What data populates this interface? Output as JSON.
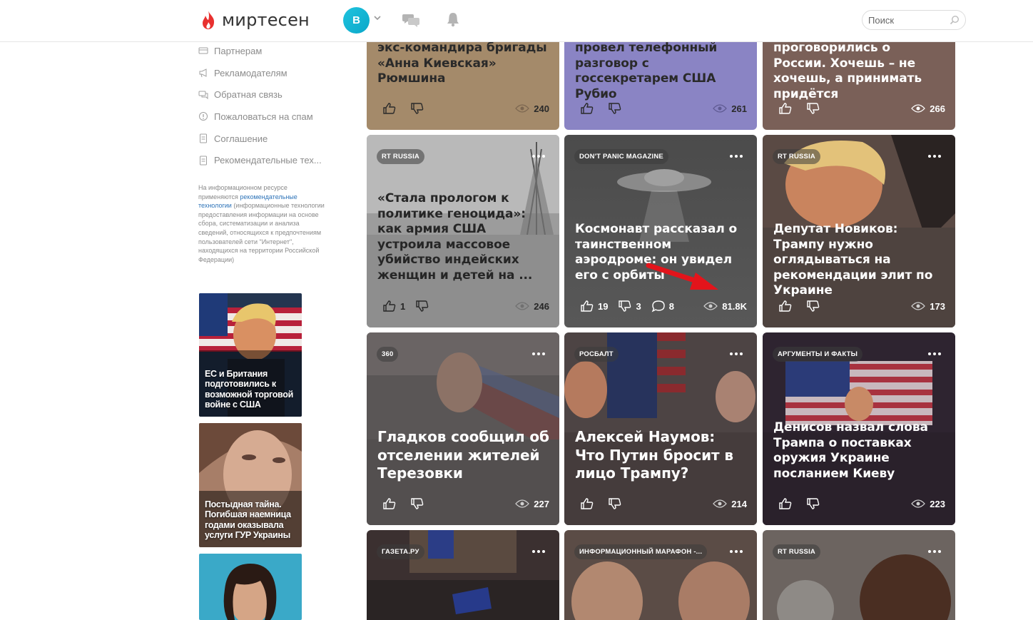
{
  "header": {
    "logo_text": "миртесен",
    "avatar_letter": "В",
    "search_placeholder": "Поиск"
  },
  "sidebar": {
    "links": [
      {
        "label": "Партнерам",
        "icon": "card-icon"
      },
      {
        "label": "Рекламодателям",
        "icon": "megaphone-icon"
      },
      {
        "label": "Обратная связь",
        "icon": "chat-bubbles-icon"
      },
      {
        "label": "Пожаловаться на спам",
        "icon": "warning-circle-icon"
      },
      {
        "label": "Соглашение",
        "icon": "document-icon"
      },
      {
        "label": "Рекомендательные тех...",
        "icon": "document-icon"
      }
    ],
    "notice_before": "На информационном ресурсе применяются ",
    "notice_link": "рекомендательные технологии",
    "notice_after": " (информационные технологии предоставления информации на основе сбора, систематизации и анализа сведений, относящихся к предпочтениям пользователей сети \"Интернет\", находящихся на территории Российской Федерации)",
    "promo": [
      {
        "title": "ЕС и Британия подготовились к возможной торговой войне с США"
      },
      {
        "title": "Постыдная тайна. Погибшая наемница годами оказывала услуги ГУР Украины"
      },
      {
        "title": ""
      }
    ]
  },
  "feed": [
    {
      "source": "",
      "title": "экс-командира бригады «Анна Киевская» Рюмшина",
      "likes": "",
      "dislikes": "",
      "comments": "",
      "views": "240"
    },
    {
      "source": "",
      "title": "провел телефонный разговор с госсекретарем США Рубио",
      "likes": "",
      "dislikes": "",
      "comments": "",
      "views": "261"
    },
    {
      "source": "",
      "title": "проговорились о России. Хочешь – не хочешь, а принимать придётся",
      "likes": "",
      "dislikes": "",
      "comments": "",
      "views": "266"
    },
    {
      "source": "RT RUSSIA",
      "title": "«Стала прологом к политике геноцида»: как армия США устроила массовое убийство индейских женщин и детей на ...",
      "likes": "1",
      "dislikes": "",
      "comments": "",
      "views": "246"
    },
    {
      "source": "DON'T PANIC MAGAZINE",
      "title": "Космонавт рассказал о таинственном аэродроме: он увидел его с орбиты",
      "likes": "19",
      "dislikes": "3",
      "comments": "8",
      "views": "81.8K"
    },
    {
      "source": "RT RUSSIA",
      "title": "Депутат Новиков: Трампу нужно оглядываться на рекомендации элит по Украине",
      "likes": "",
      "dislikes": "",
      "comments": "",
      "views": "173"
    },
    {
      "source": "360",
      "title": "Гладков сообщил об отселении жителей Терезовки",
      "likes": "",
      "dislikes": "",
      "comments": "",
      "views": "227"
    },
    {
      "source": "РОСБАЛТ",
      "title": "Алексей Наумов: Что Путин бросит в лицо Трампу?",
      "likes": "",
      "dislikes": "",
      "comments": "",
      "views": "214"
    },
    {
      "source": "АРГУМЕНТЫ И ФАКТЫ",
      "title": "Денисов назвал слова Трампа о поставках оружия Украине посланием Киеву",
      "likes": "",
      "dislikes": "",
      "comments": "",
      "views": "223"
    },
    {
      "source": "ГАЗЕТА.РУ",
      "title": "",
      "likes": "",
      "dislikes": "",
      "comments": "",
      "views": ""
    },
    {
      "source": "ИНФОРМАЦИОННЫЙ МАРАФОН -...",
      "title": "",
      "likes": "",
      "dislikes": "",
      "comments": "",
      "views": ""
    },
    {
      "source": "RT RUSSIA",
      "title": "",
      "likes": "",
      "dislikes": "",
      "comments": "",
      "views": ""
    }
  ],
  "colors": {
    "brand_red": "#e8312f",
    "avatar_cyan": "#12b5d6",
    "annotation_arrow": "#e3141b"
  }
}
